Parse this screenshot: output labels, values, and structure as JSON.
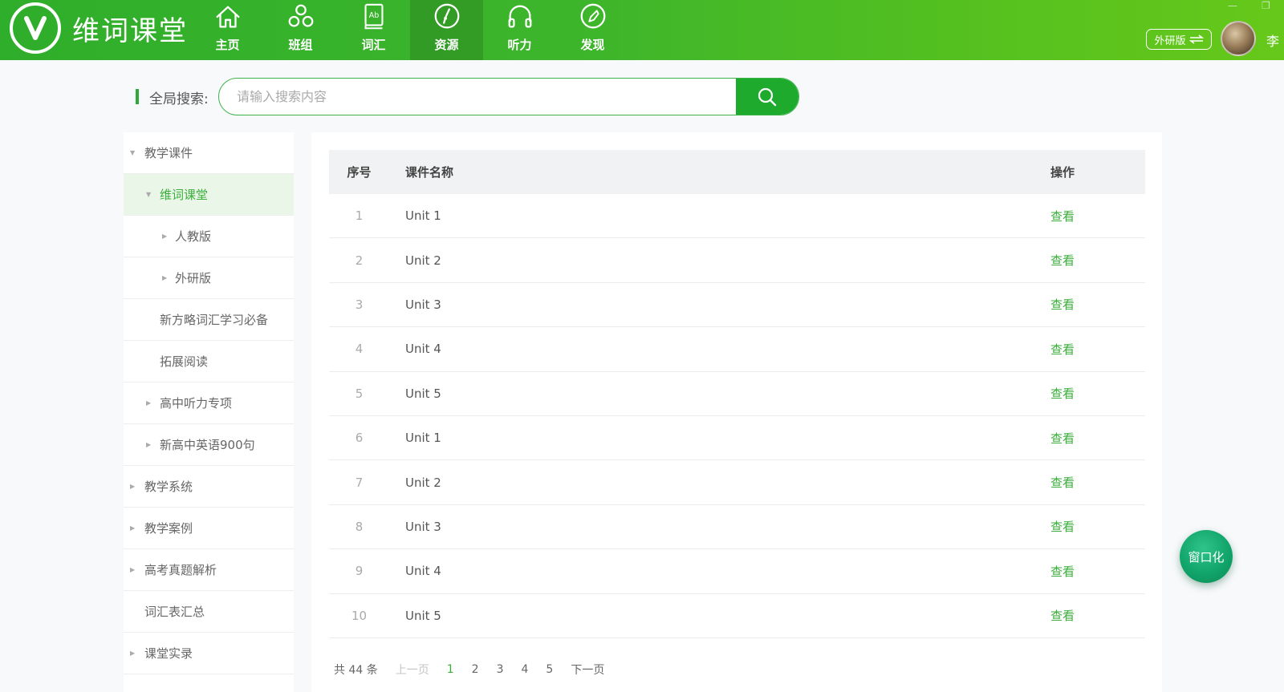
{
  "app": {
    "logo_letter": "V",
    "name": "维词课堂",
    "brand_color": "#3db52b",
    "accent_color": "#1eab2d"
  },
  "nav": [
    {
      "label": "主页",
      "icon": "home-icon"
    },
    {
      "label": "班组",
      "icon": "group-icon"
    },
    {
      "label": "词汇",
      "icon": "book-icon",
      "icon_text": "Ab"
    },
    {
      "label": "资源",
      "icon": "compass-icon",
      "active": true
    },
    {
      "label": "听力",
      "icon": "headphones-icon"
    },
    {
      "label": "发现",
      "icon": "discover-icon"
    }
  ],
  "header": {
    "version_label": "外研版",
    "username": "李"
  },
  "search": {
    "label": "全局搜索:",
    "placeholder": "请输入搜索内容"
  },
  "sidebar": [
    {
      "label": "教学课件",
      "level": 0,
      "caret": "down"
    },
    {
      "label": "维词课堂",
      "level": 1,
      "caret": "down",
      "active": true
    },
    {
      "label": "人教版",
      "level": 2,
      "caret": "right"
    },
    {
      "label": "外研版",
      "level": 2,
      "caret": "right"
    },
    {
      "label": "新方略词汇学习必备",
      "level": 1,
      "caret": ""
    },
    {
      "label": "拓展阅读",
      "level": 1,
      "caret": ""
    },
    {
      "label": "高中听力专项",
      "level": 1,
      "caret": "right"
    },
    {
      "label": "新高中英语900句",
      "level": 1,
      "caret": "right"
    },
    {
      "label": "教学系统",
      "level": 0,
      "caret": "right"
    },
    {
      "label": "教学案例",
      "level": 0,
      "caret": "right"
    },
    {
      "label": "高考真题解析",
      "level": 0,
      "caret": "right"
    },
    {
      "label": "词汇表汇总",
      "level": 0,
      "caret": ""
    },
    {
      "label": "课堂实录",
      "level": 0,
      "caret": "right"
    }
  ],
  "table": {
    "headers": {
      "index": "序号",
      "name": "课件名称",
      "op": "操作"
    },
    "rows": [
      {
        "index": "1",
        "name": "Unit 1",
        "op": "查看"
      },
      {
        "index": "2",
        "name": "Unit 2",
        "op": "查看"
      },
      {
        "index": "3",
        "name": "Unit 3",
        "op": "查看"
      },
      {
        "index": "4",
        "name": "Unit 4",
        "op": "查看"
      },
      {
        "index": "5",
        "name": "Unit 5",
        "op": "查看"
      },
      {
        "index": "6",
        "name": "Unit 1",
        "op": "查看"
      },
      {
        "index": "7",
        "name": "Unit 2",
        "op": "查看"
      },
      {
        "index": "8",
        "name": "Unit 3",
        "op": "查看"
      },
      {
        "index": "9",
        "name": "Unit 4",
        "op": "查看"
      },
      {
        "index": "10",
        "name": "Unit 5",
        "op": "查看"
      }
    ]
  },
  "pagination": {
    "total": "共 44 条",
    "prev": "上一页",
    "pages": [
      "1",
      "2",
      "3",
      "4",
      "5"
    ],
    "current": "1",
    "next": "下一页"
  },
  "float_button": {
    "label": "窗口化"
  }
}
